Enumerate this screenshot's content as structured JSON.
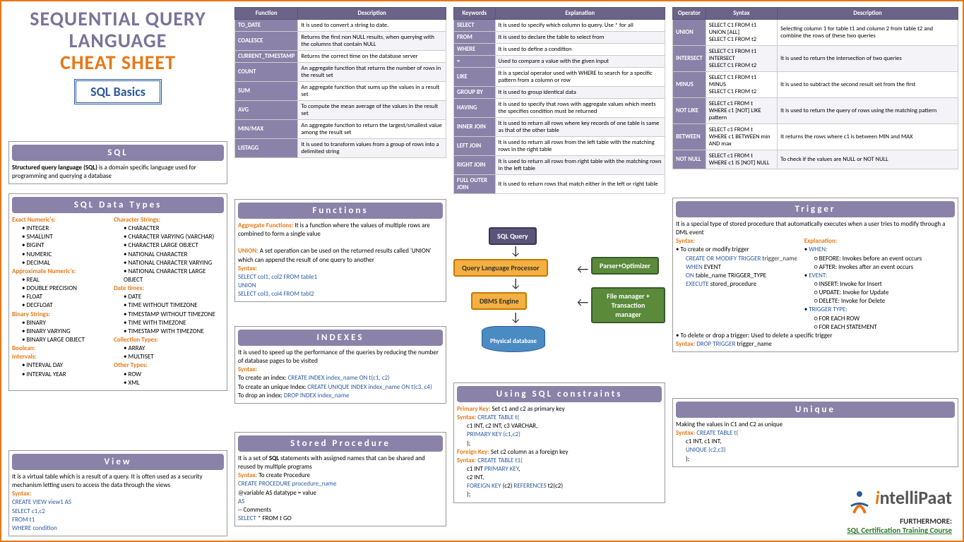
{
  "title": {
    "line1": "SEQUENTIAL QUERY",
    "line2": "LANGUAGE",
    "line3": "CHEAT SHEET",
    "badge": "SQL Basics"
  },
  "sql": {
    "header": "SQL",
    "body": "Structured query language (SQL) is a domain specific language used for programming and querying a database"
  },
  "datatypes": {
    "header": "SQL Data Types",
    "exact_label": "Exact Numeric's:",
    "exact": [
      "INTEGER",
      "SMALLINT",
      "BIGINT",
      "NUMERIC",
      "DECIMAL"
    ],
    "approx_label": "Approximate Numeric's:",
    "approx": [
      "REAL",
      "DOUBLE PRECISION",
      "FLOAT",
      "DECFLOAT"
    ],
    "binary_label": "Binary Strings:",
    "binary": [
      "BINARY",
      "BINARY VARYING",
      "BINARY LARGE OBJECT"
    ],
    "bool_label": "Boolean:",
    "interval_label": "Intervals:",
    "intervals": [
      "INTERVAL DAY",
      "INTERVAL YEAR"
    ],
    "char_label": "Character Strings:",
    "chars": [
      "CHARACTER",
      "CHARACTER VARYING (VARCHAR)",
      "CHARACTER LARGE OBJECT",
      "NATIONAL CHARACTER",
      "NATIONAL CHARACTER VARYING",
      "NATIONAL CHARACTER LARGE OBJECT"
    ],
    "date_label": "Date times:",
    "dates": [
      "DATE",
      "TIME WITHOUT TIMEZONE",
      "TIMESTAMP WITHOUT TIMEZONE",
      "TIME WITH TIMEZONE",
      "TIMESTAMP WITH TIMEZONE"
    ],
    "coll_label": "Collection Types:",
    "colls": [
      "ARRAY",
      "MULTISET"
    ],
    "other_label": "Other Types:",
    "others": [
      "ROW",
      "XML"
    ]
  },
  "view": {
    "header": "View",
    "body": "It is a virtual table which is a result of a query. It is often used as a security mechanism letting users to access the data through the views",
    "syntax_label": "Syntax:",
    "l1": "CREATE VIEW view1 AS",
    "l2": "SELECT c1,c2",
    "l3": "FROM t1",
    "l4": "WHERE condition"
  },
  "funcTable": {
    "h1": "Function",
    "h2": "Description",
    "rows": [
      [
        "TO_DATE",
        "It is used to convert a string to date."
      ],
      [
        "COALESCE",
        "Returns the first non NULL results, when querying with the columns that contain NULL"
      ],
      [
        "CURRENT_TIMESTAMP",
        "Returns the correct time on the database server"
      ],
      [
        "COUNT",
        "An aggregate function that returns the number of rows in the result set"
      ],
      [
        "SUM",
        "An aggregate function that sums up the values in a result set"
      ],
      [
        "AVG",
        "To compute the mean average of the values in the result set"
      ],
      [
        "MIN/MAX",
        "An aggregate function to return the largest/smallest value among the result set"
      ],
      [
        "LISTAGG",
        "It is used to transform values from a group of rows into a delimited string"
      ]
    ]
  },
  "functions": {
    "header": "Functions",
    "agg_label": "Aggregate Functions:",
    "agg": " It is a function where the values of multiple rows are combined to form a single value",
    "union_label": "UNION:",
    "union": " A set operation can be used on the returned results called 'UNION' which can append the result of one query to another",
    "syntax_label": "Syntax:",
    "l1": "SELECT col1, col2 FROM table1",
    "l2": "UNION",
    "l3": "SELECT col3, col4 FROM tabl2"
  },
  "indexes": {
    "header": "INDEXES",
    "body": "It is used to speed up the performance of the queries by reducing the number of database pages to be visited",
    "syntax_label": "Syntax:",
    "l1p": "To create an index: ",
    "l1c": "CREATE INDEX index_name ON t(c1, c2)",
    "l2p": "To create an unique Index: ",
    "l2c": "CREATE UNIQUE INDEX index_name ON t(c3, c4)",
    "l3p": "To drop an index: ",
    "l3c": "DROP INDEX index_name"
  },
  "storedproc": {
    "header": "Stored Procedure",
    "body": "It is a set of SQL statements with assigned names that can be shared and reused by multiple programs",
    "syntax_label": "Syntax:",
    "syntax_text": " To create Procedure",
    "l1": "CREATE PROCEDURE procedure_name",
    "l2": "@variable AS datatype = value",
    "l3": "AS",
    "l4": "-- Comments",
    "l5": "SELECT * FROM t GO"
  },
  "keywordTable": {
    "h1": "Keywords",
    "h2": "Explanation",
    "rows": [
      [
        "SELECT",
        "It is used to specify which column to query. Use * for all"
      ],
      [
        "FROM",
        "It is used to declare the table to select from"
      ],
      [
        "WHERE",
        "It is used to define a condition"
      ],
      [
        "=",
        "Used to compare a value with the given input"
      ],
      [
        "LIKE",
        "It is a special operator used with WHERE to search for a specific pattern from a column or row"
      ],
      [
        "GROUP BY",
        "It is used to group identical data"
      ],
      [
        "HAVING",
        "It is used to specify that rows with aggregate values which meets the specifies condition must be returned"
      ],
      [
        "INNER JOIN",
        "It is used to return all rows where key records of one table is same as that of the other table"
      ],
      [
        "LEFT JOIN",
        "It is used to return all rows from the left table with the matching rows in the right table"
      ],
      [
        "RIGHT JOIN",
        "It is used to return all rows from right table with the matching rows in the left table"
      ],
      [
        "FULL OUTER JOIN",
        "It is used to return rows that match either in the left or right table"
      ]
    ]
  },
  "flow": {
    "b1": "SQL Query",
    "b2": "Query Language Processor",
    "b3": "DBMS Engine",
    "b4": "Physical database",
    "b5": "Parser+Optimizer",
    "b6": "File manager + Transaction manager"
  },
  "constraints": {
    "header": "Using SQL constraints",
    "pk_label": "Primary Key:",
    "pk_text": " Set c1 and c2 as primary key",
    "syntax_label": "Syntax: ",
    "ct": "CREATE TABLE t(",
    "pk_l1": "c1 INT, c2 INT, c3 VARCHAR,",
    "pk_l2": "PRIMARY KEY (c1,c2)",
    "close": ");",
    "fk_label": "Foreign Key:",
    "fk_text": " Set c2 column as a foreign key",
    "ct2": "CREATE TABLE t1(",
    "fk_l1": "c1 INT PRIMARY KEY,",
    "fk_l2": "c2 INT,",
    "fk_l3": "FOREIGN KEY (c2) REFERENCES t2(c2)"
  },
  "opTable": {
    "h1": "Operator",
    "h2": "Syntax",
    "h3": "Description",
    "rows": [
      [
        "UNION",
        "SELECT C1 FROM t1\nUNION [ALL]\nSELECT C1 FROM t2",
        "Selecting column 1 for table t1 and column 2 from table t2 and combine the rows of these two queries"
      ],
      [
        "INTERSECT",
        "SELECT C1 FROM t1\nINTERSECT\nSELECT C1 FROM t2",
        "It is used to return the intersection of two queries"
      ],
      [
        "MINUS",
        "SELECT C1 FROM t1\nMINUS\nSELECT C1 FROM t2",
        "It is used to subtract the second result set from the first"
      ],
      [
        "NOT LIKE",
        "SELECT c1 FROM t\nWHERE c1 [NOT] LIKE pattern",
        "It is used to return the query of rows using the matching pattern"
      ],
      [
        "BETWEEN",
        "SELECT c1 FROM t\nWHERE c1 BETWEEN min AND max",
        "It returns the rows where c1 is between MIN and MAX"
      ],
      [
        "NOT NULL",
        "SELECT c1 FROM t\nWHERE c1 IS [NOT] NULL",
        "To check if the values are NULL or NOT NULL"
      ]
    ]
  },
  "trigger": {
    "header": "Trigger",
    "body": "It is a special type of stored procedure that automatically executes when a user tries to modify through a DML event",
    "syntax_label": "Syntax:",
    "expl_label": "Explanation:",
    "create": "To create or modify trigger",
    "l1": "CREATE OR MODIFY TRIGGER trigger_name",
    "l2": "WHEN EVENT",
    "l3": "ON table_name TRIGGER_TYPE",
    "l4": "EXECUTE stored_procedure",
    "when_label": "WHEN:",
    "when": [
      "BEFORE: Invokes before an event occurs",
      "AFTER: Invokes after an event occurs"
    ],
    "event_label": "EVENT:",
    "events": [
      "INSERT: Invoke for Insert",
      "UPDATE: Invoke for Update",
      "DELETE: Invoke for Delete"
    ],
    "tt_label": "TRIGGER TYPE:",
    "tts": [
      "FOR EACH ROW",
      "FOR EACH STATEMENT"
    ],
    "delete": "To delete or drop a trigger: Used to delete a specific trigger",
    "del_syntax": "DROP TRIGGER trigger_name"
  },
  "unique": {
    "header": "Unique",
    "body": "Making the values in C1 and C2 as unique",
    "syntax_label": "Syntax: ",
    "ct": "CREATE TABLE t(",
    "l1": "c1 INT, c1 INT,",
    "l2": "UNIQUE (c2,c3)",
    "close": ");"
  },
  "logo": {
    "brand": "ntelliPaat",
    "further": "FURTHERMORE:",
    "course": "SQL Certification Training Course"
  }
}
